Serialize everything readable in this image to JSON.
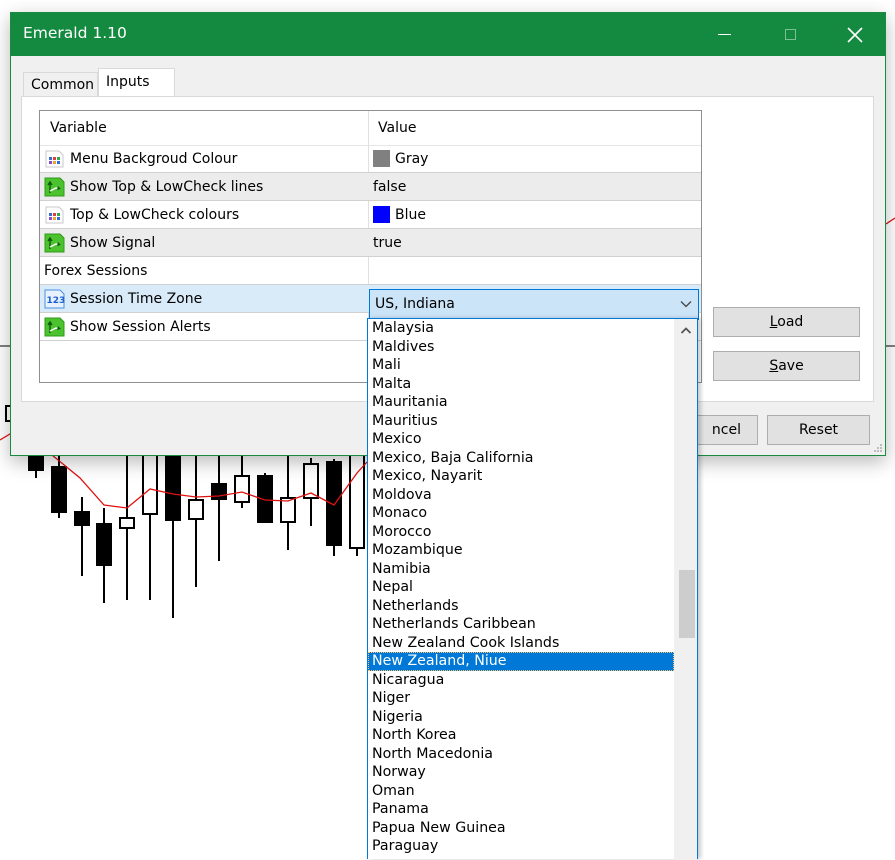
{
  "window": {
    "title": "Emerald 1.10",
    "accent_color": "#138a3f",
    "controls": {
      "minimize": "minimize-icon",
      "maximize": "maximize-icon",
      "close": "close-icon"
    }
  },
  "tabs": [
    {
      "label": "Common",
      "active": false
    },
    {
      "label": "Inputs",
      "active": true
    }
  ],
  "grid": {
    "headers": {
      "variable": "Variable",
      "value": "Value"
    },
    "rows": [
      {
        "icon": "color-param-icon",
        "variable": "Menu Backgroud Colour",
        "value": "Gray",
        "swatch": "#808080"
      },
      {
        "icon": "bool-param-icon",
        "variable": "Show Top & LowCheck lines",
        "value": "false"
      },
      {
        "icon": "color-param-icon",
        "variable": "Top & LowCheck colours",
        "value": "Blue",
        "swatch": "#0000ff"
      },
      {
        "icon": "bool-param-icon",
        "variable": "Show Signal",
        "value": "true"
      },
      {
        "icon": "",
        "variable": "Forex Sessions",
        "value": ""
      },
      {
        "icon": "number-param-icon",
        "variable": "Session Time Zone",
        "value": "US, Indiana",
        "selected": true
      },
      {
        "icon": "bool-param-icon",
        "variable": "Show Session Alerts",
        "value": ""
      }
    ]
  },
  "combo": {
    "selected_value": "US, Indiana",
    "options_visible": [
      "Malaysia",
      "Maldives",
      "Mali",
      "Malta",
      "Mauritania",
      "Mauritius",
      "Mexico",
      "Mexico, Baja California",
      "Mexico, Nayarit",
      "Moldova",
      "Monaco",
      "Morocco",
      "Mozambique",
      "Namibia",
      "Nepal",
      "Netherlands",
      "Netherlands Caribbean",
      "New Zealand Cook Islands",
      "New Zealand, Niue",
      "Nicaragua",
      "Niger",
      "Nigeria",
      "North Korea",
      "North Macedonia",
      "Norway",
      "Oman",
      "Panama",
      "Papua New Guinea",
      "Paraguay"
    ],
    "highlighted_option": "New Zealand, Niue",
    "scroll_position": 0.53
  },
  "buttons": {
    "load": "Load",
    "save": "Save",
    "cancel": "Cancel",
    "cancel_visible": "ncel",
    "reset": "Reset"
  },
  "background_chart": {
    "candle_color_up": "#ffffff",
    "candle_color_down": "#000000",
    "ma_line_color": "#e01010"
  }
}
